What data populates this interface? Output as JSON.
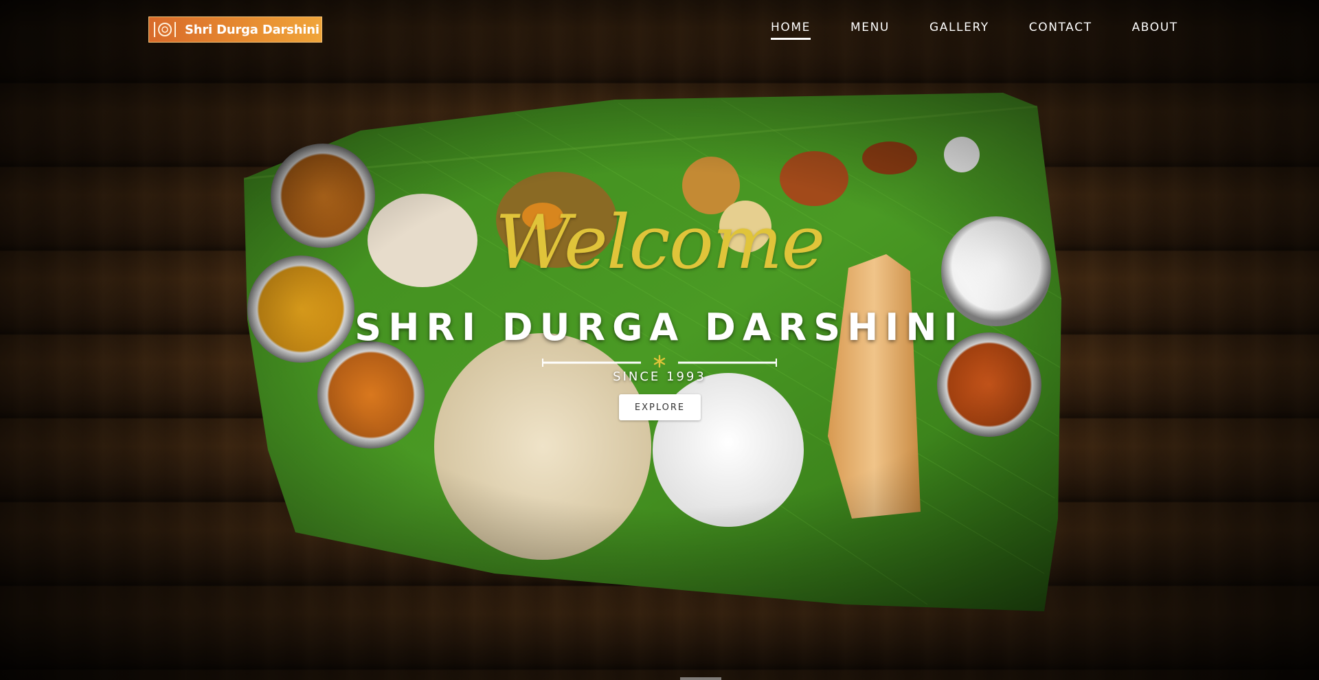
{
  "header": {
    "logo_text": "Shri Durga Darshini",
    "logo_icon": "plate-fork-knife-icon",
    "nav": [
      {
        "label": "HOME",
        "active": true
      },
      {
        "label": "MENU",
        "active": false
      },
      {
        "label": "GALLERY",
        "active": false
      },
      {
        "label": "CONTACT",
        "active": false
      },
      {
        "label": "ABOUT",
        "active": false
      }
    ]
  },
  "hero": {
    "welcome": "Welcome",
    "title": "SHRI DURGA DARSHINI",
    "since": "SINCE 1993",
    "explore_label": "EXPLORE",
    "divider_icon": "asterisk-icon"
  },
  "colors": {
    "accent_gold": "#e0c43a",
    "logo_orange": "#e68a30",
    "leaf_green": "#3f8a1e",
    "wood_brown": "#3a2410"
  }
}
